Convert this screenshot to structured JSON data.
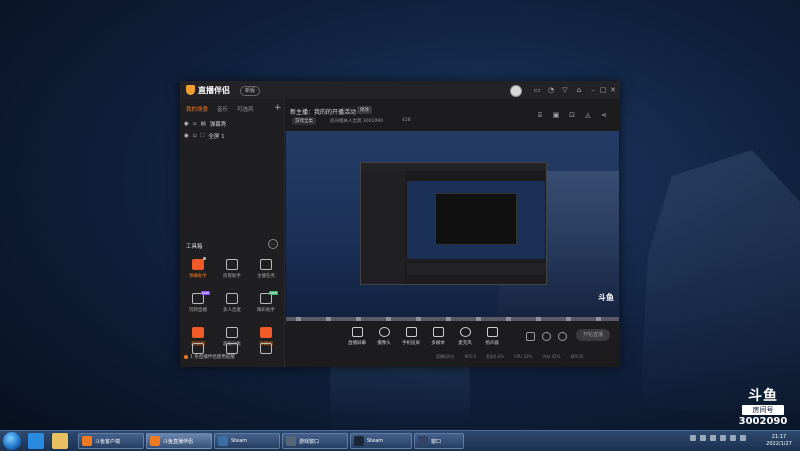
{
  "colors": {
    "accent": "#f07a20",
    "app_bg": "#1c1c1f",
    "desktop": "#10223f"
  },
  "app": {
    "name": "直播伴侣",
    "version_label": "新版",
    "header_icons": [
      "gift-icon",
      "share-icon",
      "filter-icon",
      "shirt-icon",
      "maximize-icon",
      "minimize-icon",
      "close-icon"
    ],
    "sidebar": {
      "tabs": [
        {
          "label": "我的场景",
          "active": true
        },
        {
          "label": "音乐",
          "active": false
        },
        {
          "label": "可选风",
          "active": false
        }
      ],
      "sources": [
        {
          "label": "弹幕秀"
        },
        {
          "label": "全屏 1"
        }
      ],
      "tools_title": "工具箱",
      "tools": [
        {
          "label": "弹幕助手",
          "icon": "danmu-helper-icon",
          "highlight": true
        },
        {
          "label": "房管助手",
          "icon": "room-manager-icon",
          "highlight": false
        },
        {
          "label": "主播任务",
          "icon": "task-icon",
          "highlight": false
        },
        {
          "label": "玩转直播",
          "icon": "play-live-icon",
          "highlight": false,
          "badge": "new"
        },
        {
          "label": "多人连麦",
          "icon": "multi-mic-icon",
          "highlight": false
        },
        {
          "label": "精彩助手",
          "icon": "highlight-helper-icon",
          "highlight": false,
          "badge": "new"
        },
        {
          "label": "超级图",
          "icon": "super-image-icon",
          "highlight": true
        },
        {
          "label": "超级对象",
          "icon": "super-object-icon",
          "highlight": false
        },
        {
          "label": "弹幕图",
          "icon": "danmu-image-icon",
          "highlight": true
        },
        {
          "label": "",
          "icon": "more-tool-icon",
          "highlight": false
        },
        {
          "label": "",
          "icon": "vip-tool-icon",
          "highlight": false
        },
        {
          "label": "",
          "icon": "download-tool-icon",
          "highlight": false
        }
      ],
      "notice": "1 条直播伴侣使用提醒"
    },
    "room": {
      "title": "新主播：我的的开播活动",
      "tag": "修改",
      "category": "游戏全类",
      "info": "房间相关人出现 3002090",
      "heat": "428"
    },
    "bottom_buttons": [
      {
        "label": "直播屏幕",
        "icon": "screen-capture-icon"
      },
      {
        "label": "摄像头",
        "icon": "camera-icon"
      },
      {
        "label": "手机投屏",
        "icon": "phone-cast-icon"
      },
      {
        "label": "多媒体",
        "icon": "media-icon"
      },
      {
        "label": "麦克风",
        "icon": "microphone-icon"
      },
      {
        "label": "扬声器",
        "icon": "speaker-icon"
      }
    ],
    "start_live_label": "开始直播",
    "status": [
      "直播码0分",
      "8P5.0",
      "丢帧0.0%",
      "CPU 22%",
      "内存 42%",
      "帧0/26"
    ]
  },
  "watermark": {
    "logo": "斗鱼",
    "sub": "房间号",
    "room_id": "3002090"
  },
  "taskbar": {
    "pinned": [
      {
        "icon": "ie-icon",
        "color": "#2a8ae0"
      },
      {
        "icon": "explorer-icon",
        "color": "#e8c060"
      },
      {
        "icon": "media-player-icon",
        "color": "#ff8c00"
      }
    ],
    "tasks": [
      {
        "label": "斗鱼客户端",
        "icon": "douyu-icon",
        "color": "#f07a20",
        "active": false
      },
      {
        "label": "斗鱼直播伴侣",
        "icon": "companion-icon",
        "color": "#f07a20",
        "active": true
      },
      {
        "label": "Steam",
        "icon": "steam-icon",
        "color": "#3a6ea5",
        "active": false
      },
      {
        "label": "游戏窗口",
        "icon": "game-icon",
        "color": "#556677",
        "active": false
      },
      {
        "label": "Steam",
        "icon": "steam-icon",
        "color": "#1b2838",
        "active": false
      },
      {
        "label": "窗口",
        "icon": "window-icon",
        "color": "#334466",
        "active": false
      }
    ],
    "clock": {
      "time": "21:17",
      "date": "2022/1/27"
    }
  }
}
